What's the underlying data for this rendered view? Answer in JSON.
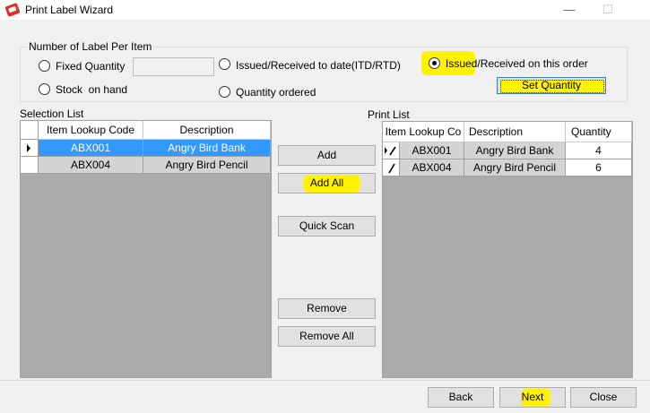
{
  "window": {
    "title": "Print Label Wizard",
    "minimize": "—",
    "maximize": "☐"
  },
  "group": {
    "legend": "Number of Label Per Item",
    "options": [
      {
        "label": "Fixed Quantity",
        "checked": false
      },
      {
        "label": "Stock  on hand",
        "checked": false
      },
      {
        "label": "Issued/Received to date(ITD/RTD)",
        "checked": false
      },
      {
        "label": "Quantity ordered",
        "checked": false
      },
      {
        "label_highlight": "Issued",
        "label_rest": "/Received on this order",
        "checked": true
      }
    ],
    "fixed_quantity_value": "",
    "set_quantity": "Set Quantity"
  },
  "selection": {
    "title": "Selection List",
    "columns": [
      "Item Lookup Code",
      "Description"
    ],
    "rows": [
      {
        "code": "ABX001",
        "description": "Angry Bird Bank"
      },
      {
        "code": "ABX004",
        "description": "Angry Bird Pencil"
      }
    ]
  },
  "buttons": {
    "add": "Add",
    "add_all": "Add All",
    "quick_scan": "Quick Scan",
    "remove": "Remove",
    "remove_all": "Remove All"
  },
  "print": {
    "title": "Print List",
    "columns": [
      "Item Lookup Co",
      "Description",
      "Quantity"
    ],
    "rows": [
      {
        "code": "ABX001",
        "description": "Angry Bird Bank",
        "quantity": "4"
      },
      {
        "code": "ABX004",
        "description": "Angry Bird Pencil",
        "quantity": "6"
      }
    ]
  },
  "footer": {
    "back": "Back",
    "next": "Next",
    "close": "Close"
  },
  "colors": {
    "highlight": "#fff200",
    "selection": "#3399ff",
    "title_icon": "#d9302c"
  }
}
